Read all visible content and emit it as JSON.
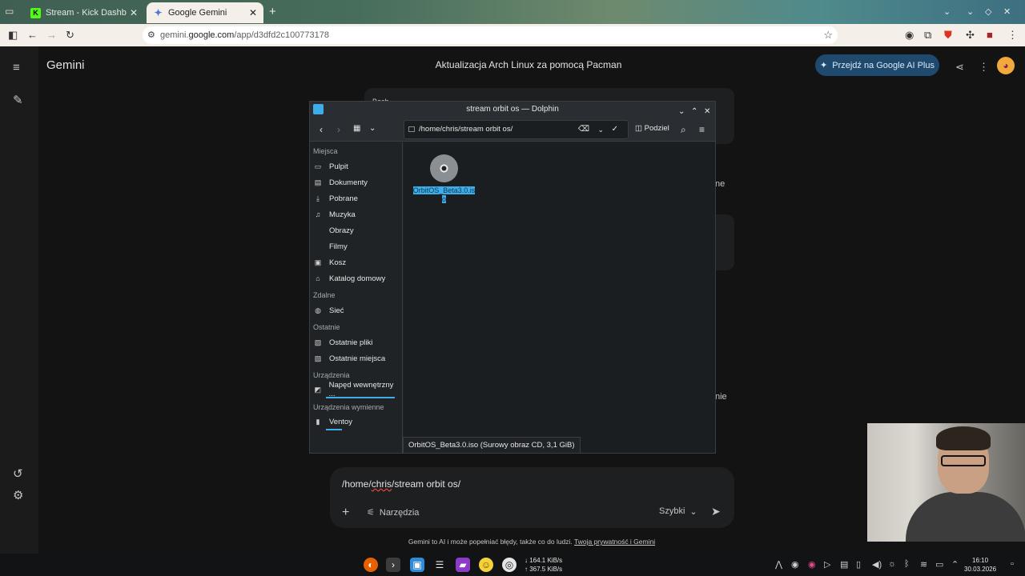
{
  "browser": {
    "tabs": [
      {
        "title": "Stream - Kick Dashboard",
        "active": false
      },
      {
        "title": "Google Gemini",
        "active": true
      }
    ],
    "url_prefix": "gemini.",
    "url_host": "google.com",
    "url_path": "/app/d3dfd2c100773178"
  },
  "gemini": {
    "brand": "Gemini",
    "conversation_title": "Aktualizacja Arch Linux za pomocą Pacman",
    "upgrade_label": "Przejdź na Google AI Plus",
    "bg_fragments": [
      "Bash",
      "ne",
      "nie"
    ],
    "prompt": {
      "value_before": "/home/",
      "value_spell": "chris",
      "value_after": "/stream orbit os/",
      "tools_label": "Narzędzia",
      "mode_label": "Szybki"
    },
    "disclaimer": "Gemini to AI i może popełniać błędy, także co do ludzi.",
    "disclaimer_link": "Twoja prywatność i Gemini"
  },
  "dolphin": {
    "title": "stream orbit os — Dolphin",
    "path": "/home/chris/stream orbit os/",
    "split_label": "Podziel",
    "places": {
      "sections": [
        {
          "heading": "Miejsca",
          "items": [
            {
              "label": "Pulpit",
              "icon": "desktop-icon"
            },
            {
              "label": "Dokumenty",
              "icon": "document-icon"
            },
            {
              "label": "Pobrane",
              "icon": "download-icon"
            },
            {
              "label": "Muzyka",
              "icon": "music-icon"
            },
            {
              "label": "Obrazy",
              "icon": ""
            },
            {
              "label": "Filmy",
              "icon": ""
            },
            {
              "label": "Kosz",
              "icon": "trash-icon"
            },
            {
              "label": "Katalog domowy",
              "icon": "home-icon"
            }
          ]
        },
        {
          "heading": "Zdalne",
          "items": [
            {
              "label": "Sieć",
              "icon": "network-icon"
            }
          ]
        },
        {
          "heading": "Ostatnie",
          "items": [
            {
              "label": "Ostatnie pliki",
              "icon": "recent-files-icon"
            },
            {
              "label": "Ostatnie miejsca",
              "icon": "recent-places-icon"
            }
          ]
        },
        {
          "heading": "Urządzenia",
          "items": [
            {
              "label": "Napęd wewnętrzny ...",
              "icon": "drive-icon"
            }
          ]
        },
        {
          "heading": "Urządzenia wymienne",
          "items": [
            {
              "label": "Ventoy",
              "icon": "usb-icon"
            }
          ]
        }
      ]
    },
    "file": {
      "name_line1": "OrbitOS_Beta3.0.is",
      "name_line2": "o"
    },
    "status": "OrbitOS_Beta3.0.iso (Surowy obraz CD, 3,1 GiB)"
  },
  "taskbar": {
    "down_speed": "↓ 164.1 KiB/s",
    "up_speed": "↑ 367.5 KiB/s",
    "time": "16:10",
    "date": "30.03.2026"
  }
}
